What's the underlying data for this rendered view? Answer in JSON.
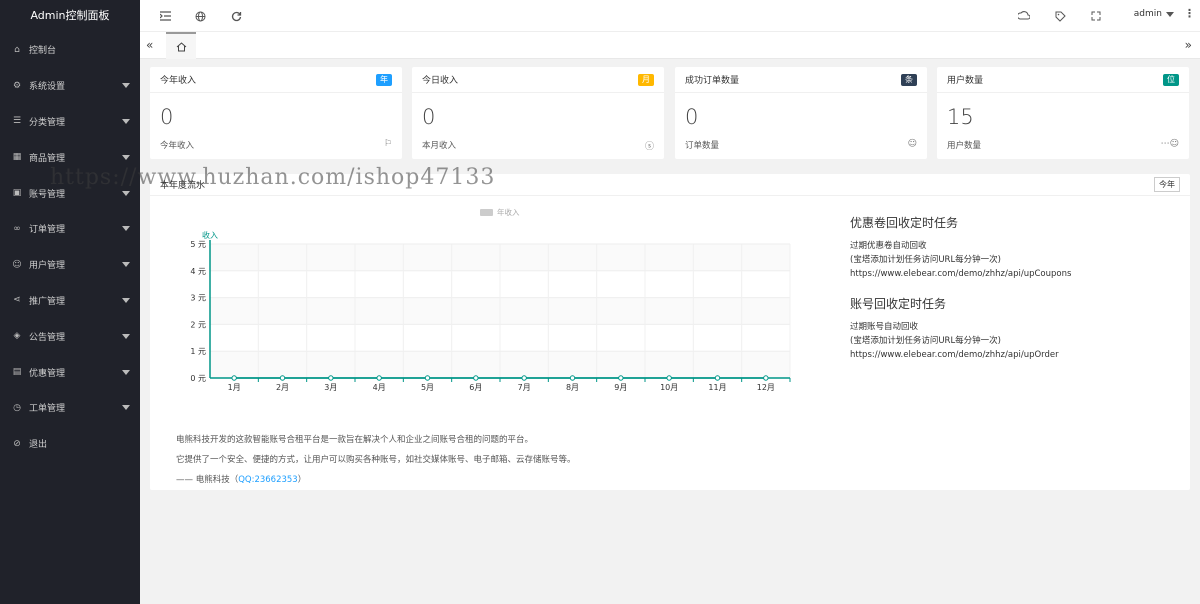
{
  "app": {
    "logo": "Admin控制面板"
  },
  "sidebar": {
    "items": [
      {
        "label": "控制台",
        "icon": "home-icon",
        "has_caret": false
      },
      {
        "label": "系统设置",
        "icon": "gear-icon",
        "has_caret": true
      },
      {
        "label": "分类管理",
        "icon": "list-icon",
        "has_caret": true
      },
      {
        "label": "商品管理",
        "icon": "goods-icon",
        "has_caret": true
      },
      {
        "label": "账号管理",
        "icon": "account-icon",
        "has_caret": true
      },
      {
        "label": "订单管理",
        "icon": "link-icon",
        "has_caret": true
      },
      {
        "label": "用户管理",
        "icon": "user-icon",
        "has_caret": true
      },
      {
        "label": "推广管理",
        "icon": "share-icon",
        "has_caret": true
      },
      {
        "label": "公告管理",
        "icon": "notice-icon",
        "has_caret": true
      },
      {
        "label": "优惠管理",
        "icon": "coupon-icon",
        "has_caret": true
      },
      {
        "label": "工单管理",
        "icon": "clock-icon",
        "has_caret": true
      },
      {
        "label": "退出",
        "icon": "logout-icon",
        "has_caret": false
      }
    ]
  },
  "header": {
    "user": "admin"
  },
  "stats": [
    {
      "title": "今年收入",
      "badge": "年",
      "badge_color": "#1E9FFF",
      "value": "0",
      "sub": "今年收入",
      "icon": "flag-icon"
    },
    {
      "title": "今日收入",
      "badge": "月",
      "badge_color": "#FFB800",
      "value": "0",
      "sub": "本月收入",
      "icon": "dollar-icon"
    },
    {
      "title": "成功订单数量",
      "badge": "条",
      "badge_color": "#2F4056",
      "value": "0",
      "sub": "订单数量",
      "icon": "smile-icon"
    },
    {
      "title": "用户数量",
      "badge": "位",
      "badge_color": "#009688",
      "value": "15",
      "sub": "用户数量",
      "icon": "user-group-icon"
    }
  ],
  "panel": {
    "title": "本年度流水",
    "button": "今年"
  },
  "chart_data": {
    "type": "line",
    "legend": [
      "年收入"
    ],
    "legend_position": "top-center",
    "ylabel": "收入",
    "ylim": [
      0,
      5
    ],
    "yticks": [
      "0 元",
      "1 元",
      "2 元",
      "3 元",
      "4 元",
      "5 元"
    ],
    "categories": [
      "1月",
      "2月",
      "3月",
      "4月",
      "5月",
      "6月",
      "7月",
      "8月",
      "9月",
      "10月",
      "11月",
      "12月"
    ],
    "series": [
      {
        "name": "年收入",
        "values": [
          0,
          0,
          0,
          0,
          0,
          0,
          0,
          0,
          0,
          0,
          0,
          0
        ]
      }
    ],
    "line_color": "#009688",
    "grid": true
  },
  "tasks": [
    {
      "title": "优惠卷回收定时任务",
      "lines": [
        "过期优惠卷自动回收",
        "(宝塔添加计划任务访问URL每分钟一次)",
        "https://www.elebear.com/demo/zhhz/api/upCoupons"
      ]
    },
    {
      "title": "账号回收定时任务",
      "lines": [
        "过期账号自动回收",
        "(宝塔添加计划任务访问URL每分钟一次)",
        "https://www.elebear.com/demo/zhhz/api/upOrder"
      ]
    }
  ],
  "footer": {
    "line1": "电熊科技开发的这款智能账号合租平台是一款旨在解决个人和企业之间账号合租的问题的平台。",
    "line2": "它提供了一个安全、便捷的方式，让用户可以购买各种账号，如社交媒体账号、电子邮箱、云存储账号等。",
    "author": "—— 电熊科技（",
    "qq": "QQ:23662353",
    "author_end": "）"
  },
  "watermark": "https://www.huzhan.com/ishop47133"
}
